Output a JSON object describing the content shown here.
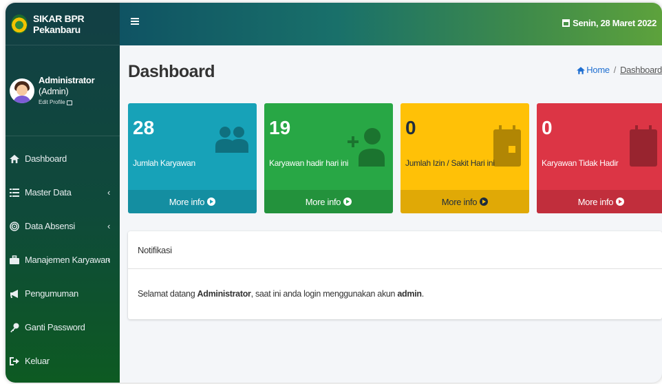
{
  "brand": {
    "name": "SIKAR BPR Pekanbaru"
  },
  "user": {
    "name": "Administrator",
    "role": "(Admin)",
    "edit_profile": "Edit Profile"
  },
  "nav": [
    {
      "label": "Dashboard",
      "icon": "home-icon"
    },
    {
      "label": "Master Data",
      "icon": "list-icon",
      "arrow": "‹"
    },
    {
      "label": "Data Absensi",
      "icon": "fingerprint-icon",
      "arrow": "‹"
    },
    {
      "label": "Manajemen Karyawan",
      "icon": "briefcase-icon",
      "arrow": "‹"
    },
    {
      "label": "Pengumuman",
      "icon": "bullhorn-icon"
    },
    {
      "label": "Ganti Password",
      "icon": "key-icon"
    },
    {
      "label": "Keluar",
      "icon": "sign-out-icon"
    }
  ],
  "topbar": {
    "date": "Senin, 28 Maret 2022"
  },
  "page": {
    "title": "Dashboard"
  },
  "breadcrumb": {
    "home": "Home",
    "separator": "/",
    "current": "Dashboard"
  },
  "stats": [
    {
      "value": "28",
      "label": "Jumlah Karyawan",
      "more": "More info",
      "color": "#17a2b8",
      "icon": "users-icon"
    },
    {
      "value": "19",
      "label": "Karyawan hadir hari ini",
      "more": "More info",
      "color": "#28a745",
      "icon": "user-plus-icon"
    },
    {
      "value": "0",
      "label": "Jumlah Izin / Sakit Hari ini",
      "more": "More info",
      "color": "#ffc107",
      "icon": "calendar-day-icon"
    },
    {
      "value": "0",
      "label": "Karyawan Tidak Hadir",
      "more": "More info",
      "color": "#dc3545",
      "icon": "calendar-icon"
    }
  ],
  "notification": {
    "title": "Notifikasi",
    "text_before": "Selamat datang ",
    "user": "Administrator",
    "text_middle": ", saat ini anda login menggunakan akun ",
    "account": "admin",
    "text_after": "."
  }
}
